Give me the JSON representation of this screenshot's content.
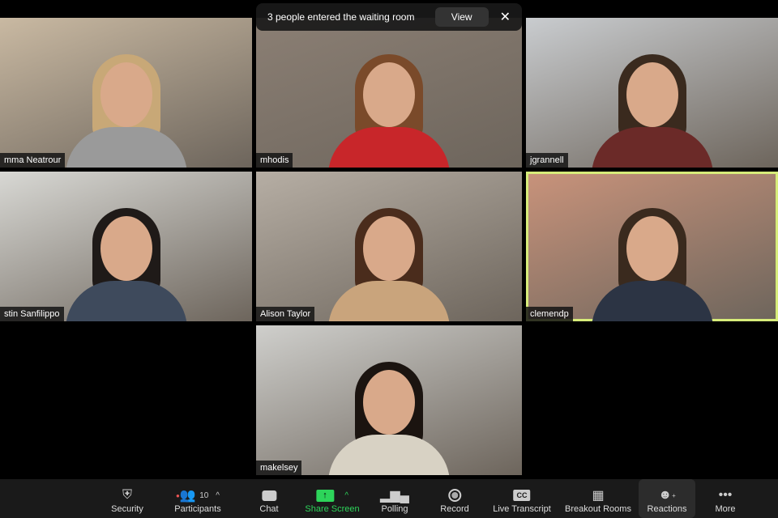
{
  "notification": {
    "text": "3 people entered the waiting room",
    "view_label": "View"
  },
  "tiles": [
    {
      "name": "mma Neatrour",
      "bg": "#c9b9a2",
      "hair": "#c8a877",
      "shirt": "#9a9a9a",
      "active": false
    },
    {
      "name": "mhodis",
      "bg": "#8b7f74",
      "hair": "#7a4a2a",
      "shirt": "#c8262a",
      "active": false
    },
    {
      "name": "jgrannell",
      "bg": "#c9cccf",
      "hair": "#3a2a1e",
      "shirt": "#6b2a28",
      "active": false
    },
    {
      "name": "stin Sanfilippo",
      "bg": "#d8d8d4",
      "hair": "#1f1a18",
      "shirt": "#3e4a5c",
      "active": false
    },
    {
      "name": "Alison Taylor",
      "bg": "#b6aea4",
      "hair": "#4a2c1c",
      "shirt": "#c9a47c",
      "active": false
    },
    {
      "name": "clemendp",
      "bg": "#c9937b",
      "hair": "#3a2a1e",
      "shirt": "#2c3444",
      "active": true
    },
    {
      "name": "makelsey",
      "bg": "#cfcfcc",
      "hair": "#1b1410",
      "shirt": "#d8d2c4",
      "active": false
    }
  ],
  "toolbar": {
    "security": "Security",
    "participants": "Participants",
    "participants_count": "10",
    "chat": "Chat",
    "share_screen": "Share Screen",
    "polling": "Polling",
    "record": "Record",
    "live_transcript": "Live Transcript",
    "cc": "CC",
    "breakout_rooms": "Breakout Rooms",
    "reactions": "Reactions",
    "more": "More"
  },
  "colors": {
    "active_speaker": "#d7ec7a",
    "share_green": "#2dd45a"
  }
}
